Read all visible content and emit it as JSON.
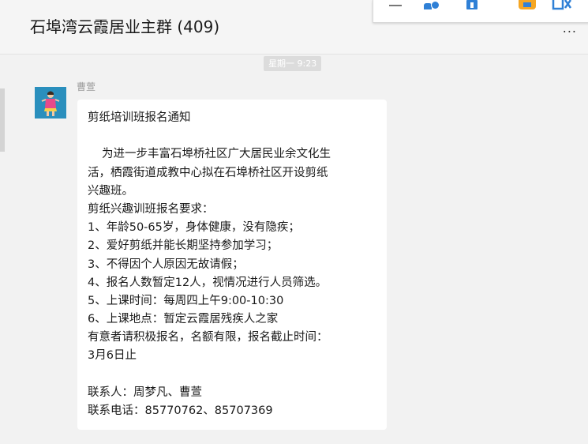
{
  "header": {
    "title": "石埠湾云霞居业主群 (409)",
    "more_label": "..."
  },
  "toolbar": {
    "icons": [
      "minimize-icon",
      "add-member-icon",
      "file-icon",
      "app-icon",
      "screen-share-icon"
    ]
  },
  "chat": {
    "timestamp": "星期一 9:23",
    "message": {
      "sender": "曹萱",
      "lines": [
        "剪纸培训班报名通知",
        "",
        "为进一步丰富石埠桥社区广大居民业余文化生",
        "活，栖霞街道成教中心拟在石埠桥社区开设剪纸",
        "兴趣班。",
        "剪纸兴趣训班报名要求：",
        "1、年龄50-65岁，身体健康，没有隐疾；",
        "2、爱好剪纸并能长期坚持参加学习；",
        "3、不得因个人原因无故请假；",
        "4、报名人数暂定12人，视情况进行人员筛选。",
        "5、上课时间：每周四上午9:00-10:30",
        "6、上课地点：暂定云霞居残疾人之家",
        "有意者请积极报名，名额有限，报名截止时间：",
        "3月6日止",
        "",
        "联系人：周梦凡、曹萱",
        "联系电话：85770762、85707369"
      ]
    }
  }
}
